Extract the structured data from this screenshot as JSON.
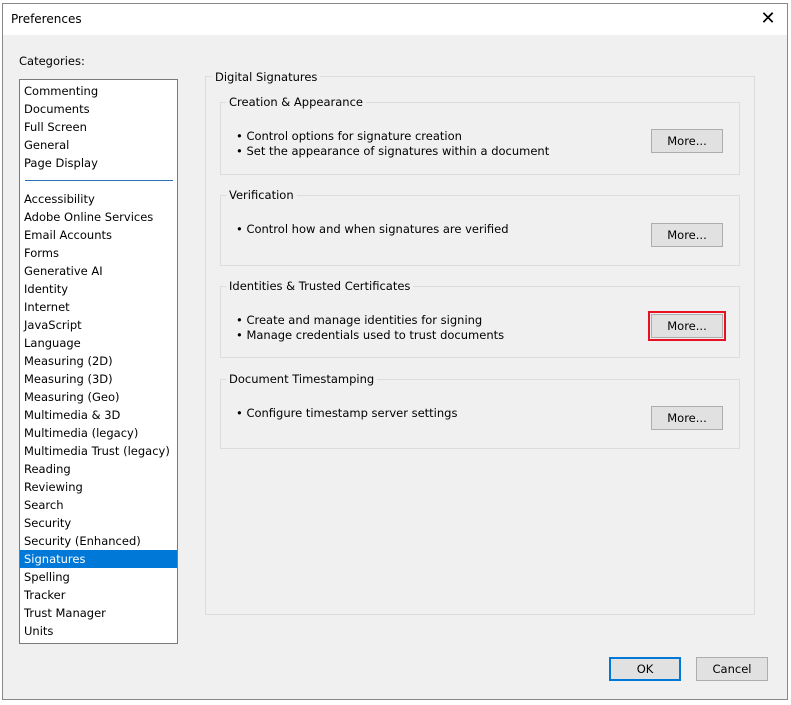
{
  "window": {
    "title": "Preferences",
    "close_icon": "close-icon"
  },
  "categories": {
    "label": "Categories:",
    "top_items": [
      "Commenting",
      "Documents",
      "Full Screen",
      "General",
      "Page Display"
    ],
    "items": [
      "Accessibility",
      "Adobe Online Services",
      "Email Accounts",
      "Forms",
      "Generative AI",
      "Identity",
      "Internet",
      "JavaScript",
      "Language",
      "Measuring (2D)",
      "Measuring (3D)",
      "Measuring (Geo)",
      "Multimedia & 3D",
      "Multimedia (legacy)",
      "Multimedia Trust (legacy)",
      "Reading",
      "Reviewing",
      "Search",
      "Security",
      "Security (Enhanced)",
      "Signatures",
      "Spelling",
      "Tracker",
      "Trust Manager",
      "Units"
    ],
    "selected": "Signatures"
  },
  "panel": {
    "title": "Digital Signatures",
    "sections": [
      {
        "title": "Creation & Appearance",
        "lines": [
          "• Control options for signature creation",
          "• Set the appearance of signatures within a document"
        ],
        "button": "More..."
      },
      {
        "title": "Verification",
        "lines": [
          "• Control how and when signatures are verified"
        ],
        "button": "More..."
      },
      {
        "title": "Identities & Trusted Certificates",
        "lines": [
          "• Create and manage identities for signing",
          "• Manage credentials used to trust documents"
        ],
        "button": "More..."
      },
      {
        "title": "Document Timestamping",
        "lines": [
          "• Configure timestamp server settings"
        ],
        "button": "More..."
      }
    ]
  },
  "footer": {
    "ok": "OK",
    "cancel": "Cancel"
  }
}
